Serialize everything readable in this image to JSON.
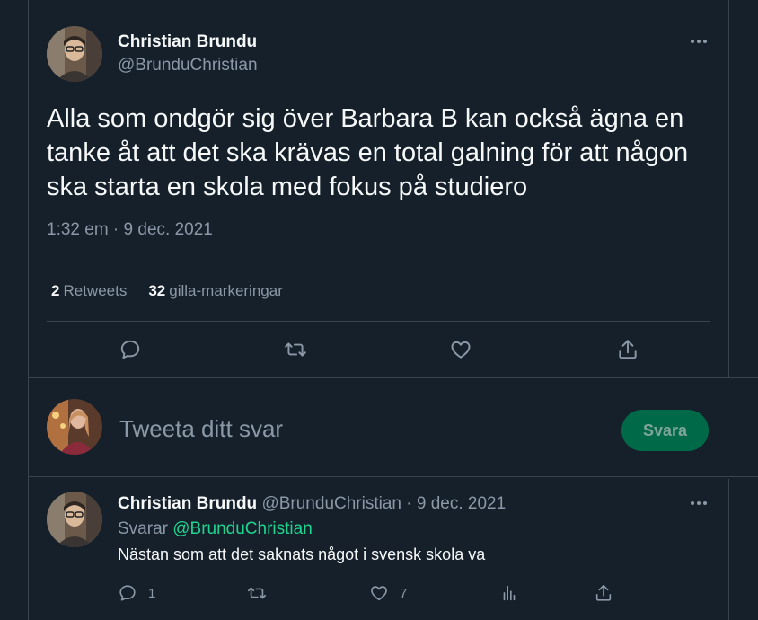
{
  "tweet": {
    "author_name": "Christian Brundu",
    "author_handle": "@BrunduChristian",
    "text": "Alla som ondgör sig över Barbara B kan också ägna en tanke åt att det ska krävas en total galning för att någon ska starta en skola med fokus på studiero",
    "timestamp": "1:32 em · 9 dec. 2021",
    "retweets_count": "2",
    "retweets_label": "Retweets",
    "likes_count": "32",
    "likes_label": "gilla-markeringar"
  },
  "compose": {
    "placeholder": "Tweeta ditt svar",
    "reply_button": "Svara"
  },
  "reply": {
    "author_name": "Christian Brundu",
    "author_handle": "@BrunduChristian",
    "date": "· 9 dec. 2021",
    "replying_to_label": "Svarar",
    "replying_to_handle": "@BrunduChristian",
    "text": "Nästan som att det saknats något i svensk skola va",
    "reply_count": "1",
    "like_count": "7"
  },
  "icons": {
    "reply": "reply-icon",
    "retweet": "retweet-icon",
    "like": "heart-icon",
    "share": "share-icon",
    "analytics": "analytics-icon",
    "more": "more-icon"
  },
  "colors": {
    "background": "#15202b",
    "accent_green": "#1ed48e",
    "button_green": "#006a48",
    "muted": "#8b98a5"
  }
}
